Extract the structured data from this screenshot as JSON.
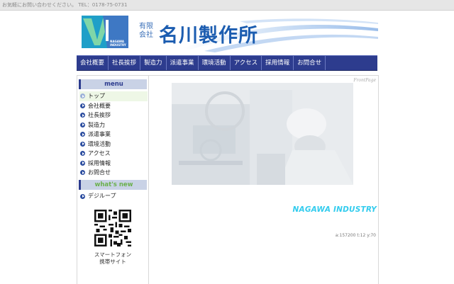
{
  "topbar": {
    "text": "お気軽にお問い合わせください。 TEL：0178-75-0731"
  },
  "header": {
    "logo_text_line1": "NAGAWA",
    "logo_text_line2": "INDUSTRY",
    "company_prefix": "有限会社",
    "company_name": "名川製作所",
    "accent_color": "#1c5db0"
  },
  "nav": {
    "items": [
      {
        "label": "会社概要"
      },
      {
        "label": "社長挨拶"
      },
      {
        "label": "製造力"
      },
      {
        "label": "派遣事業"
      },
      {
        "label": "環境活動"
      },
      {
        "label": "アクセス"
      },
      {
        "label": "採用情報"
      },
      {
        "label": "お問合せ"
      }
    ],
    "bg_color": "#2d3c8e"
  },
  "sidebar": {
    "menu_heading": "menu",
    "menu_items": [
      {
        "label": "トップ"
      },
      {
        "label": "会社概要"
      },
      {
        "label": "社長挨拶"
      },
      {
        "label": "製造力"
      },
      {
        "label": "派遣事業"
      },
      {
        "label": "環境活動"
      },
      {
        "label": "アクセス"
      },
      {
        "label": "採用情報"
      },
      {
        "label": "お問合せ"
      }
    ],
    "news_heading": "what's new",
    "news_items": [
      {
        "label": "デジループ"
      }
    ],
    "qr_caption_line1": "スマートフォン",
    "qr_caption_line2": "携帯サイト"
  },
  "content": {
    "frontpage_label": "FrontPage",
    "brand_text": "NAGAWA INDUSTRY",
    "brand_color": "#33ccee",
    "counter_text": "a:157200 t:12 y:70"
  }
}
